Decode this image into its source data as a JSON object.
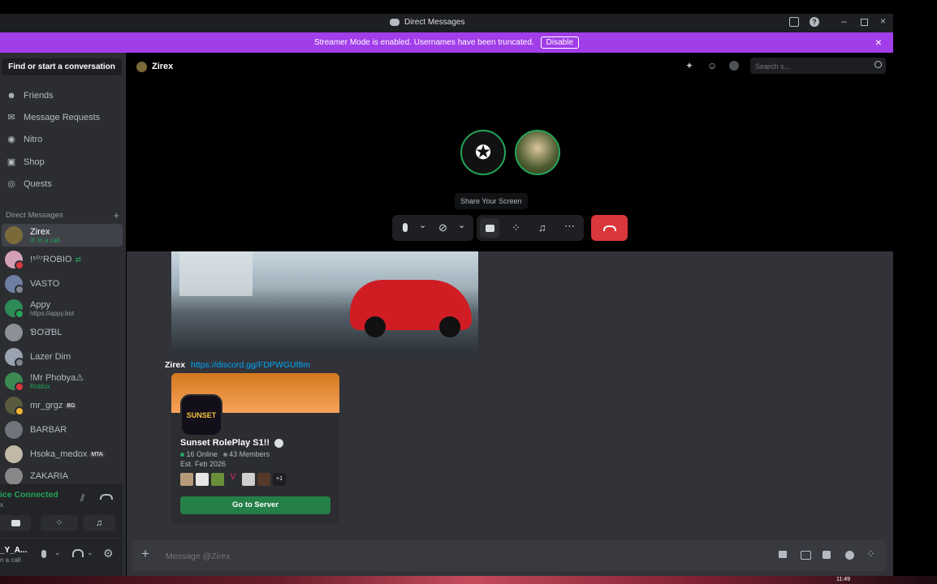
{
  "window": {
    "title": "Direct Messages"
  },
  "banner": {
    "text": "Streamer Mode is enabled. Usernames have been truncated.",
    "button": "Disable"
  },
  "sidebar": {
    "search_button": "Find or start a conversation",
    "nav": [
      {
        "label": "Friends",
        "icon": "friends-icon"
      },
      {
        "label": "Message Requests",
        "icon": "mail-icon"
      },
      {
        "label": "Nitro",
        "icon": "nitro-icon"
      },
      {
        "label": "Shop",
        "icon": "shop-icon"
      },
      {
        "label": "Quests",
        "icon": "quests-icon"
      }
    ],
    "dm_header": "Direct Messages",
    "dms": [
      {
        "name": "Zirex",
        "sub": "In a call",
        "color": "#7a6a3a"
      },
      {
        "name": "!⁵⁰⁷ROBIO",
        "sub": "",
        "color": "#d4a0b8"
      },
      {
        "name": "VASTO",
        "sub": "",
        "color": "#6f7ea3"
      },
      {
        "name": "Appy",
        "sub": "https://appy.bot",
        "color": "#2e8b57"
      },
      {
        "name": "ƁƠƋƁL",
        "sub": "",
        "color": "#8d8f96"
      },
      {
        "name": "Lazer Dim",
        "sub": "",
        "color": "#9aa3b0"
      },
      {
        "name": "!Mr Phobya⚠",
        "sub": "Roblox",
        "color": "#3b8a54"
      },
      {
        "name": "mr_grgz",
        "sub": "",
        "tag": "BG",
        "color": "#5a5a40"
      },
      {
        "name": "BARBAR",
        "sub": "",
        "color": "#70747c"
      },
      {
        "name": "Hsoka_medox",
        "sub": "",
        "tag": "MTA",
        "color": "#c2b8a8"
      },
      {
        "name": "ZAKARIA",
        "sub": "",
        "color": "#888"
      }
    ],
    "voice": {
      "status": "ice Connected",
      "sub": "x"
    },
    "user": {
      "name": "_Y_A...",
      "status": "n a call"
    }
  },
  "header": {
    "name": "Zirex",
    "search_placeholder": "Search s..."
  },
  "call": {
    "tooltip": "Share Your Screen"
  },
  "chat": {
    "author": "Zirex",
    "link": "https://discord.gg/FDPWGUf8m",
    "invite": {
      "server_name": "Sunset RolePlay S1!!",
      "online": "16 Online",
      "members": "43 Members",
      "established": "Est. Feb 2026",
      "extra": "+1",
      "button": "Go to Server",
      "logo_text": "SUNSET"
    },
    "composer_placeholder": "Message @Zirex"
  },
  "taskbar": {
    "time": "11:49"
  },
  "colors": {
    "accent": "#5865f2",
    "green": "#23a55a",
    "red": "#da373c",
    "banner": "#a23dea"
  }
}
